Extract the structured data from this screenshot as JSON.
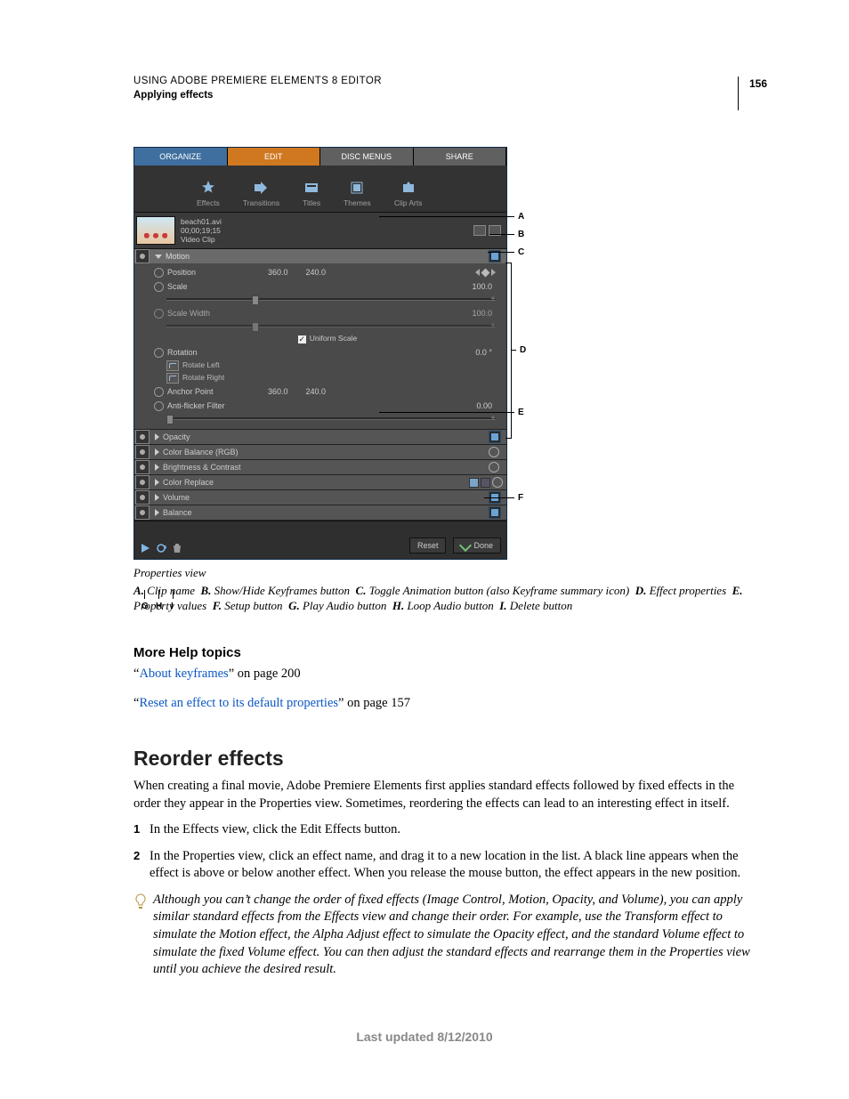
{
  "page_number": "156",
  "header": {
    "line1": "USING ADOBE PREMIERE ELEMENTS 8 EDITOR",
    "line2": "Applying effects"
  },
  "ui": {
    "tabs": {
      "organize": "ORGANIZE",
      "edit": "EDIT",
      "disc": "DISC MENUS",
      "share": "SHARE"
    },
    "tools": {
      "effects": "Effects",
      "transitions": "Transitions",
      "titles": "Titles",
      "themes": "Themes",
      "cliparts": "Clip Arts"
    },
    "clip": {
      "name": "beach01.avi",
      "tc": "00;00;19;15",
      "type": "Video Clip"
    },
    "motion": {
      "label": "Motion",
      "position": {
        "label": "Position",
        "x": "360.0",
        "y": "240.0"
      },
      "scale": {
        "label": "Scale",
        "value": "100.0"
      },
      "scalew": {
        "label": "Scale Width",
        "value": "100.0"
      },
      "uniform": "Uniform Scale",
      "rotation": {
        "label": "Rotation",
        "value": "0.0 °",
        "left": "Rotate Left",
        "right": "Rotate Right"
      },
      "anchor": {
        "label": "Anchor Point",
        "x": "360.0",
        "y": "240.0"
      },
      "flicker": {
        "label": "Anti-flicker Filter",
        "value": "0.00"
      }
    },
    "collapsed": {
      "opacity": "Opacity",
      "colorbal": "Color Balance (RGB)",
      "bright": "Brightness & Contrast",
      "replace": "Color Replace",
      "volume": "Volume",
      "balance": "Balance"
    },
    "buttons": {
      "reset": "Reset",
      "done": "Done"
    }
  },
  "callouts": {
    "a": "A",
    "b": "B",
    "c": "C",
    "d": "D",
    "e": "E",
    "f": "F",
    "g": "G",
    "h": "H",
    "i": "I"
  },
  "caption": "Properties view",
  "legend": {
    "a": "Clip name",
    "b": "Show/Hide Keyframes button",
    "c": "Toggle Animation button (also Keyframe summary icon)",
    "d": "Effect properties",
    "e": "Property values",
    "f": "Setup button",
    "g": "Play Audio button",
    "h": "Loop Audio button",
    "i": "Delete button"
  },
  "help": {
    "heading": "More Help topics",
    "link1_text": "About keyframes",
    "link1_tail": "” on page 200",
    "link2_text": "Reset an effect to its default properties",
    "link2_tail": "” on page 157"
  },
  "section": {
    "title": "Reorder effects",
    "intro": "When creating a final movie, Adobe Premiere Elements first applies standard effects followed by fixed effects in the order they appear in the Properties view. Sometimes, reordering the effects can lead to an interesting effect in itself.",
    "step1": "In the Effects view, click the Edit Effects button.",
    "step2": "In the Properties view, click an effect name, and drag it to a new location in the list. A black line appears when the effect is above or below another effect. When you release the mouse button, the effect appears in the new position.",
    "tip": "Although you can’t change the order of fixed effects (Image Control, Motion, Opacity, and Volume), you can apply similar standard effects from the Effects view and change their order. For example, use the Transform effect to simulate the Motion effect, the Alpha Adjust effect to simulate the Opacity effect, and the standard Volume effect to simulate the fixed Volume effect. You can then adjust the standard effects and rearrange them in the Properties view until you achieve the desired result."
  },
  "footer": "Last updated 8/12/2010"
}
